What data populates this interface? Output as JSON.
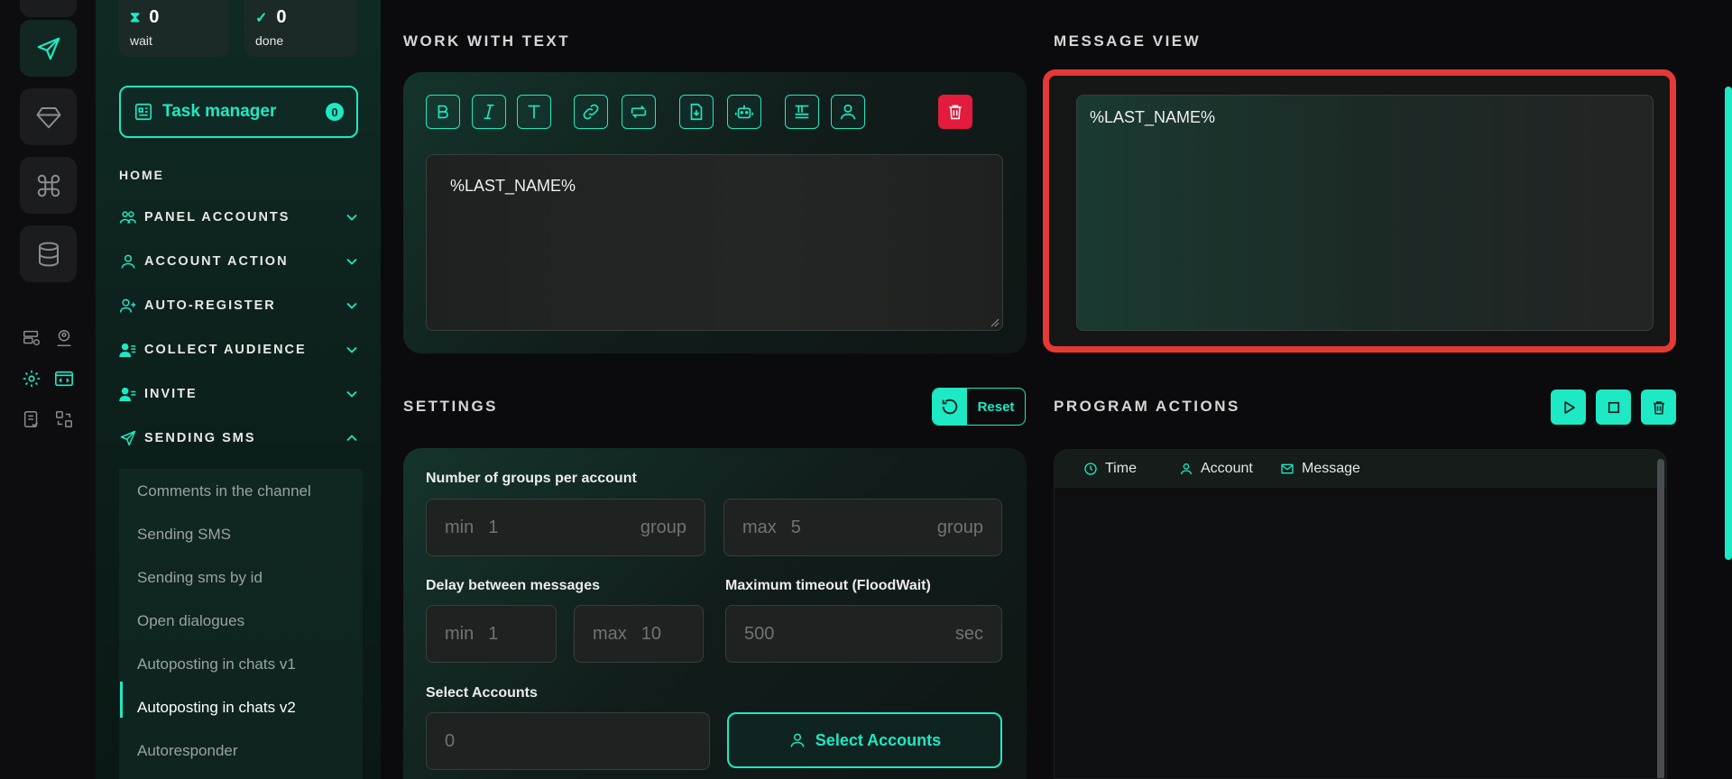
{
  "stats": {
    "wait": {
      "count": "0",
      "label": "wait"
    },
    "done": {
      "count": "0",
      "label": "done"
    }
  },
  "task_manager": {
    "label": "Task manager",
    "badge": "0"
  },
  "nav": {
    "home": "HOME",
    "items": [
      {
        "label": "PANEL ACCOUNTS"
      },
      {
        "label": "ACCOUNT ACTION"
      },
      {
        "label": "AUTO-REGISTER"
      },
      {
        "label": "COLLECT AUDIENCE"
      },
      {
        "label": "INVITE"
      },
      {
        "label": "SENDING SMS"
      }
    ],
    "sub_items": [
      {
        "label": "Comments in the channel"
      },
      {
        "label": "Sending SMS"
      },
      {
        "label": "Sending sms by id"
      },
      {
        "label": "Open dialogues"
      },
      {
        "label": "Autoposting in chats v1"
      },
      {
        "label": "Autoposting in chats v2"
      },
      {
        "label": "Autoresponder"
      }
    ]
  },
  "work_with_text": {
    "title": "WORK WITH TEXT",
    "editor_value": "%LAST_NAME%"
  },
  "message_view": {
    "title": "MESSAGE VIEW",
    "value": "%LAST_NAME%"
  },
  "settings": {
    "title": "SETTINGS",
    "reset_label": "Reset",
    "groups_label": "Number of groups per account",
    "groups_min": {
      "prefix": "min",
      "value": "1",
      "suffix": "group"
    },
    "groups_max": {
      "prefix": "max",
      "value": "5",
      "suffix": "group"
    },
    "delay_label": "Delay between messages",
    "delay_min": {
      "prefix": "min",
      "value": "1"
    },
    "delay_max": {
      "prefix": "max",
      "value": "10"
    },
    "timeout_label": "Maximum timeout (FloodWait)",
    "timeout": {
      "value": "500",
      "suffix": "sec"
    },
    "accounts_label": "Select Accounts",
    "accounts_value": "0",
    "select_accounts_button": "Select Accounts"
  },
  "program_actions": {
    "title": "PROGRAM ACTIONS",
    "columns": {
      "time": "Time",
      "account": "Account",
      "message": "Message"
    }
  },
  "colors": {
    "accent": "#1de9c4",
    "danger": "#e31b3c",
    "highlight": "#e53935"
  }
}
